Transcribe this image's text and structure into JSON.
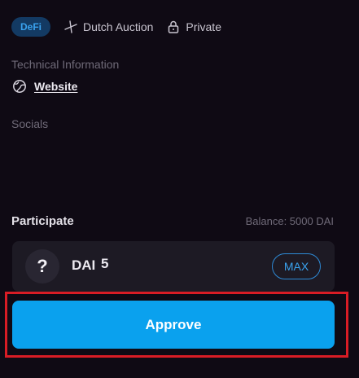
{
  "tags": {
    "category": "DeFi",
    "auction_type": "Dutch Auction",
    "visibility": "Private",
    "category_icon_color": "#3aa2ee",
    "category_bg_color": "#133a63"
  },
  "technical": {
    "label": "Technical Information",
    "website_label": "Website",
    "website_icon": "globe-icon"
  },
  "socials": {
    "label": "Socials"
  },
  "participate": {
    "title": "Participate",
    "balance": "Balance: 5000 DAI",
    "token_icon": "?",
    "token_name": "DAI",
    "amount": "5",
    "max_label": "MAX",
    "approve_label": "Approve",
    "accent_color": "#0aa1ee",
    "highlight_color": "#d91c25"
  }
}
